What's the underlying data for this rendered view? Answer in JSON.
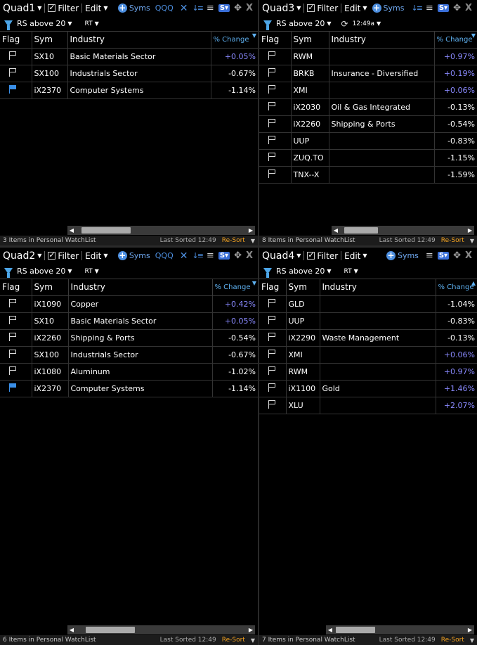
{
  "common": {
    "filter_label": "Filter",
    "edit_label": "Edit",
    "syms_label": "Syms",
    "qqq_label": "QQQ",
    "filter_name": "RS above 20",
    "rt_label": "RT",
    "col_flag": "Flag",
    "col_sym": "Sym",
    "col_industry": "Industry",
    "col_change": "% Change",
    "last_sorted": "Last Sorted 12:49",
    "resort": "Re-Sort",
    "positive_color": "#8a8aff",
    "accent_color": "#4d8fe0"
  },
  "quad1": {
    "title": "Quad1",
    "status": "3 Items in Personal WatchList",
    "rows": [
      {
        "flag": false,
        "sym": "SX10",
        "industry": "Basic Materials Sector",
        "change": "+0.05%"
      },
      {
        "flag": false,
        "sym": "SX100",
        "industry": "Industrials Sector",
        "change": "-0.67%"
      },
      {
        "flag": true,
        "sym": "iX2370",
        "industry": "Computer Systems",
        "change": "-1.14%"
      }
    ]
  },
  "quad3": {
    "title": "Quad3",
    "time": "12:49a",
    "status": "8 Items in Personal WatchList",
    "rows": [
      {
        "flag": false,
        "sym": "RWM",
        "industry": "",
        "change": "+0.97%"
      },
      {
        "flag": false,
        "sym": "BRKB",
        "industry": "Insurance - Diversified",
        "change": "+0.19%"
      },
      {
        "flag": false,
        "sym": "XMI",
        "industry": "",
        "change": "+0.06%"
      },
      {
        "flag": false,
        "sym": "iX2030",
        "industry": "Oil & Gas Integrated",
        "change": "-0.13%"
      },
      {
        "flag": false,
        "sym": "iX2260",
        "industry": "Shipping & Ports",
        "change": "-0.54%"
      },
      {
        "flag": false,
        "sym": "UUP",
        "industry": "",
        "change": "-0.83%"
      },
      {
        "flag": false,
        "sym": "ZUQ.TO",
        "industry": "",
        "change": "-1.15%"
      },
      {
        "flag": false,
        "sym": "TNX--X",
        "industry": "",
        "change": "-1.59%"
      }
    ]
  },
  "quad2": {
    "title": "Quad2",
    "status": "6 Items in Personal WatchList",
    "rows": [
      {
        "flag": false,
        "sym": "iX1090",
        "industry": "Copper",
        "change": "+0.42%"
      },
      {
        "flag": false,
        "sym": "SX10",
        "industry": "Basic Materials Sector",
        "change": "+0.05%"
      },
      {
        "flag": false,
        "sym": "iX2260",
        "industry": "Shipping & Ports",
        "change": "-0.54%"
      },
      {
        "flag": false,
        "sym": "SX100",
        "industry": "Industrials Sector",
        "change": "-0.67%"
      },
      {
        "flag": false,
        "sym": "iX1080",
        "industry": "Aluminum",
        "change": "-1.02%"
      },
      {
        "flag": true,
        "sym": "iX2370",
        "industry": "Computer Systems",
        "change": "-1.14%"
      }
    ]
  },
  "quad4": {
    "title": "Quad4",
    "status": "7 Items in Personal WatchList",
    "rows": [
      {
        "flag": false,
        "sym": "GLD",
        "industry": "",
        "change": "-1.04%"
      },
      {
        "flag": false,
        "sym": "UUP",
        "industry": "",
        "change": "-0.83%"
      },
      {
        "flag": false,
        "sym": "iX2290",
        "industry": "Waste Management",
        "change": "-0.13%"
      },
      {
        "flag": false,
        "sym": "XMI",
        "industry": "",
        "change": "+0.06%"
      },
      {
        "flag": false,
        "sym": "RWM",
        "industry": "",
        "change": "+0.97%"
      },
      {
        "flag": false,
        "sym": "iX1100",
        "industry": "Gold",
        "change": "+1.46%"
      },
      {
        "flag": false,
        "sym": "XLU",
        "industry": "",
        "change": "+2.07%"
      }
    ]
  }
}
